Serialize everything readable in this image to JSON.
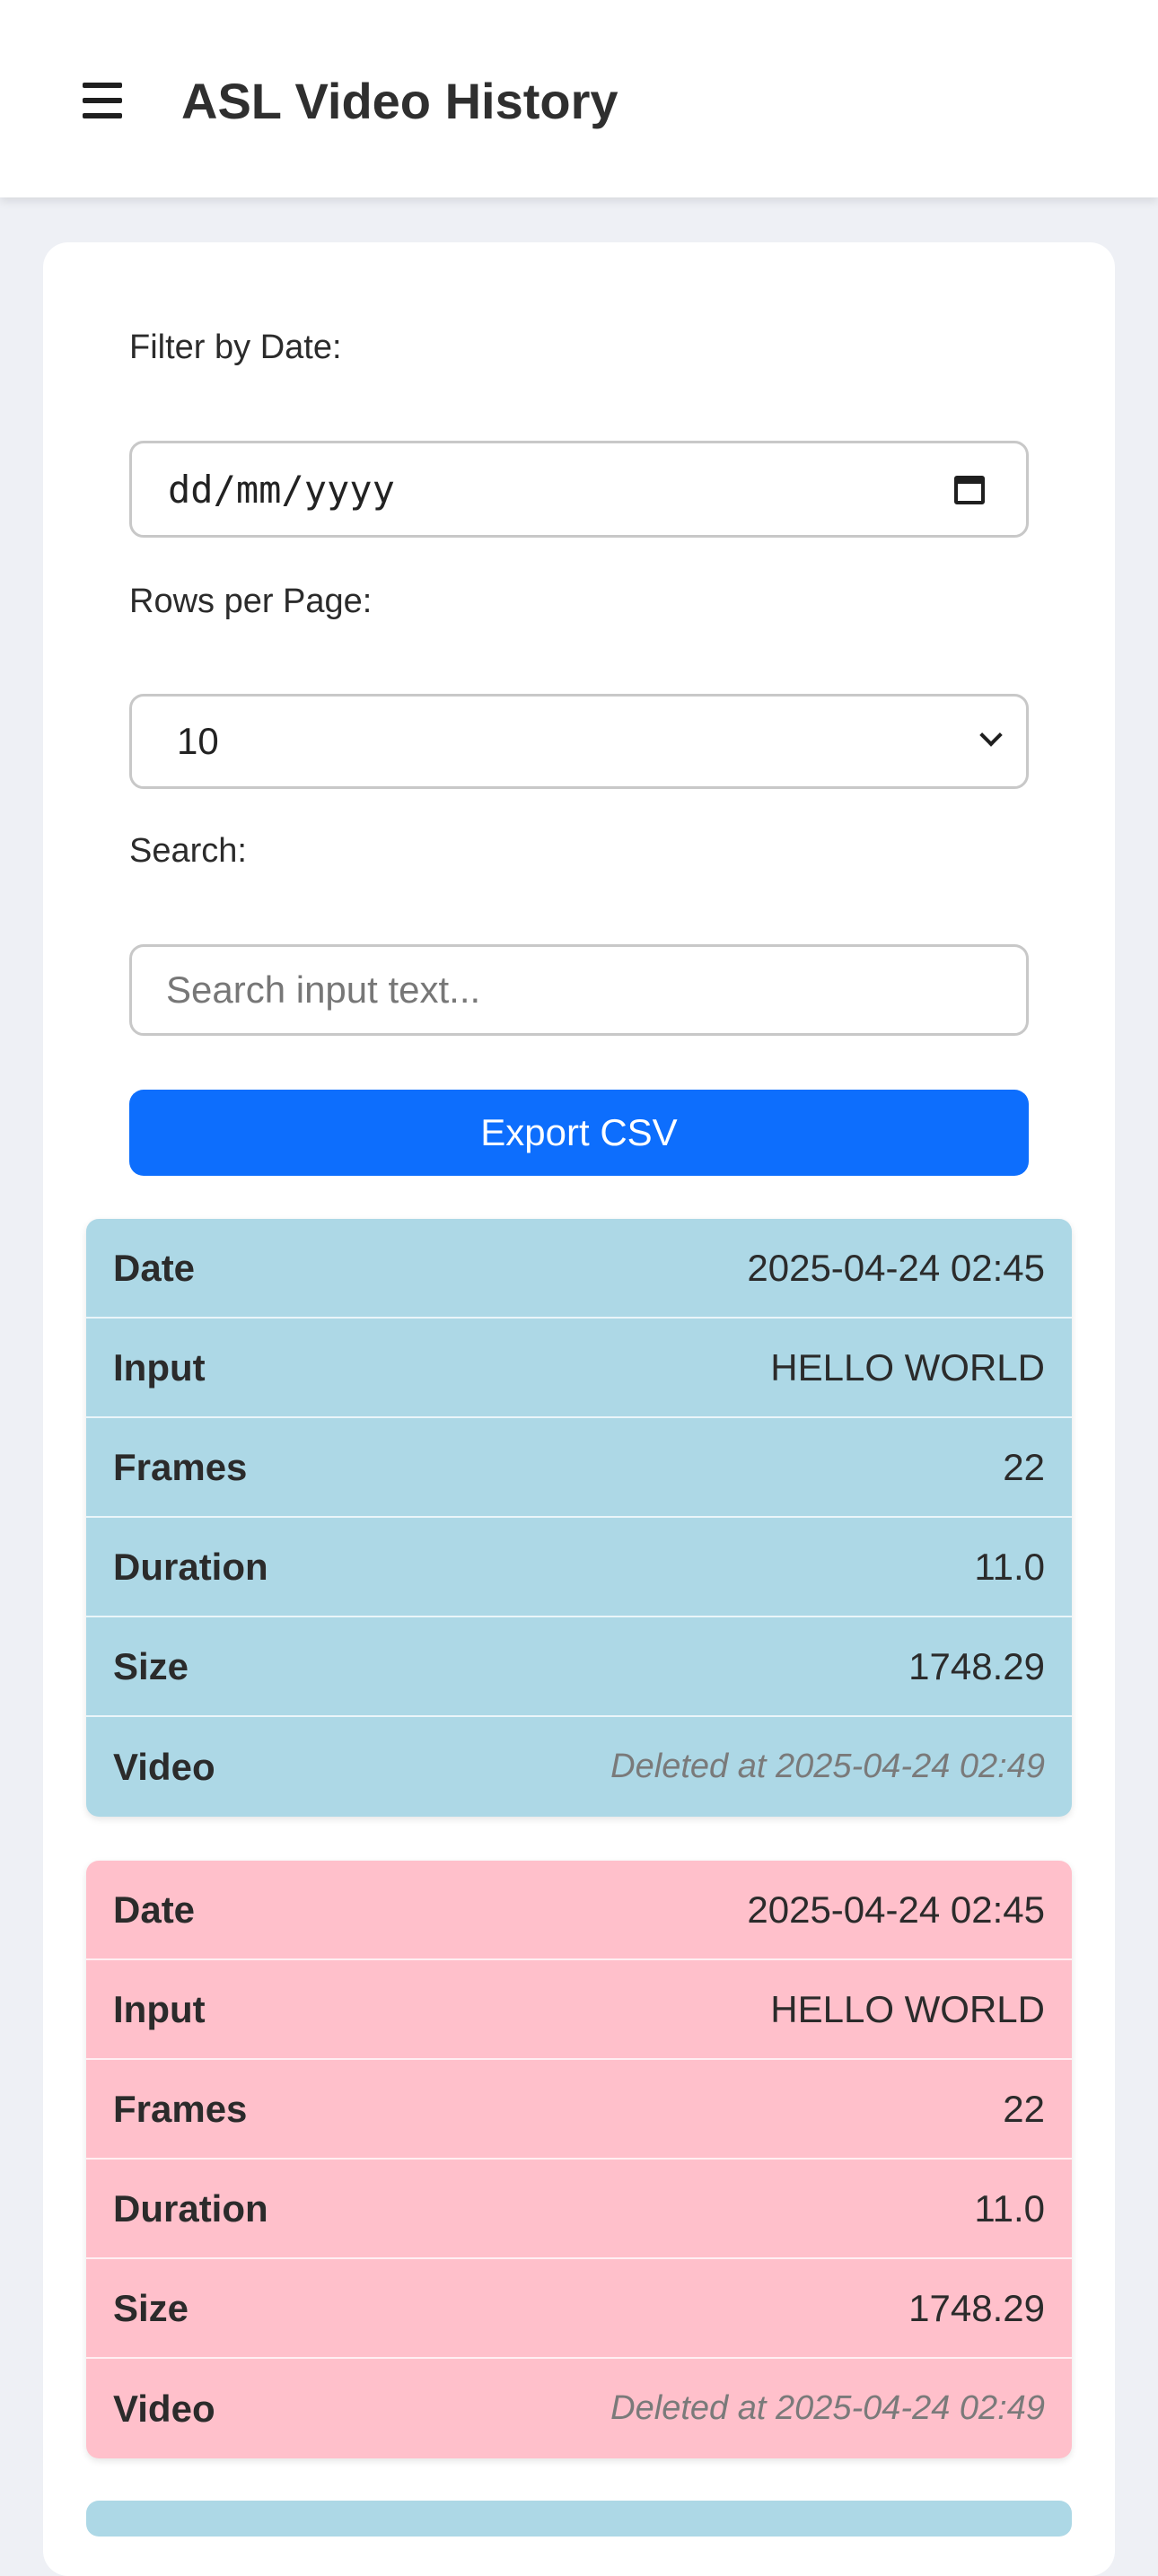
{
  "header": {
    "title": "ASL Video History",
    "menu_icon": "hamburger-menu-icon"
  },
  "filters": {
    "date_label": "Filter by Date:",
    "date_placeholder": "dd/mm/yyyy",
    "date_icon": "calendar-icon",
    "rows_label": "Rows per Page:",
    "rows_value": "10",
    "rows_icon": "chevron-down-icon",
    "search_label": "Search:",
    "search_placeholder": "Search input text..."
  },
  "actions": {
    "export_label": "Export CSV",
    "export_color": "#0d6efd"
  },
  "records": [
    {
      "color": "#add8e6",
      "fields": [
        {
          "label": "Date",
          "value": "2025-04-24 02:45"
        },
        {
          "label": "Input",
          "value": "HELLO WORLD"
        },
        {
          "label": "Frames",
          "value": "22"
        },
        {
          "label": "Duration",
          "value": "11.0"
        },
        {
          "label": "Size",
          "value": "1748.29"
        },
        {
          "label": "Video",
          "value": "Deleted at 2025-04-24 02:49"
        }
      ]
    },
    {
      "color": "#ffc0cb",
      "fields": [
        {
          "label": "Date",
          "value": "2025-04-24 02:45"
        },
        {
          "label": "Input",
          "value": "HELLO WORLD"
        },
        {
          "label": "Frames",
          "value": "22"
        },
        {
          "label": "Duration",
          "value": "11.0"
        },
        {
          "label": "Size",
          "value": "1748.29"
        },
        {
          "label": "Video",
          "value": "Deleted at 2025-04-24 02:49"
        }
      ]
    }
  ]
}
